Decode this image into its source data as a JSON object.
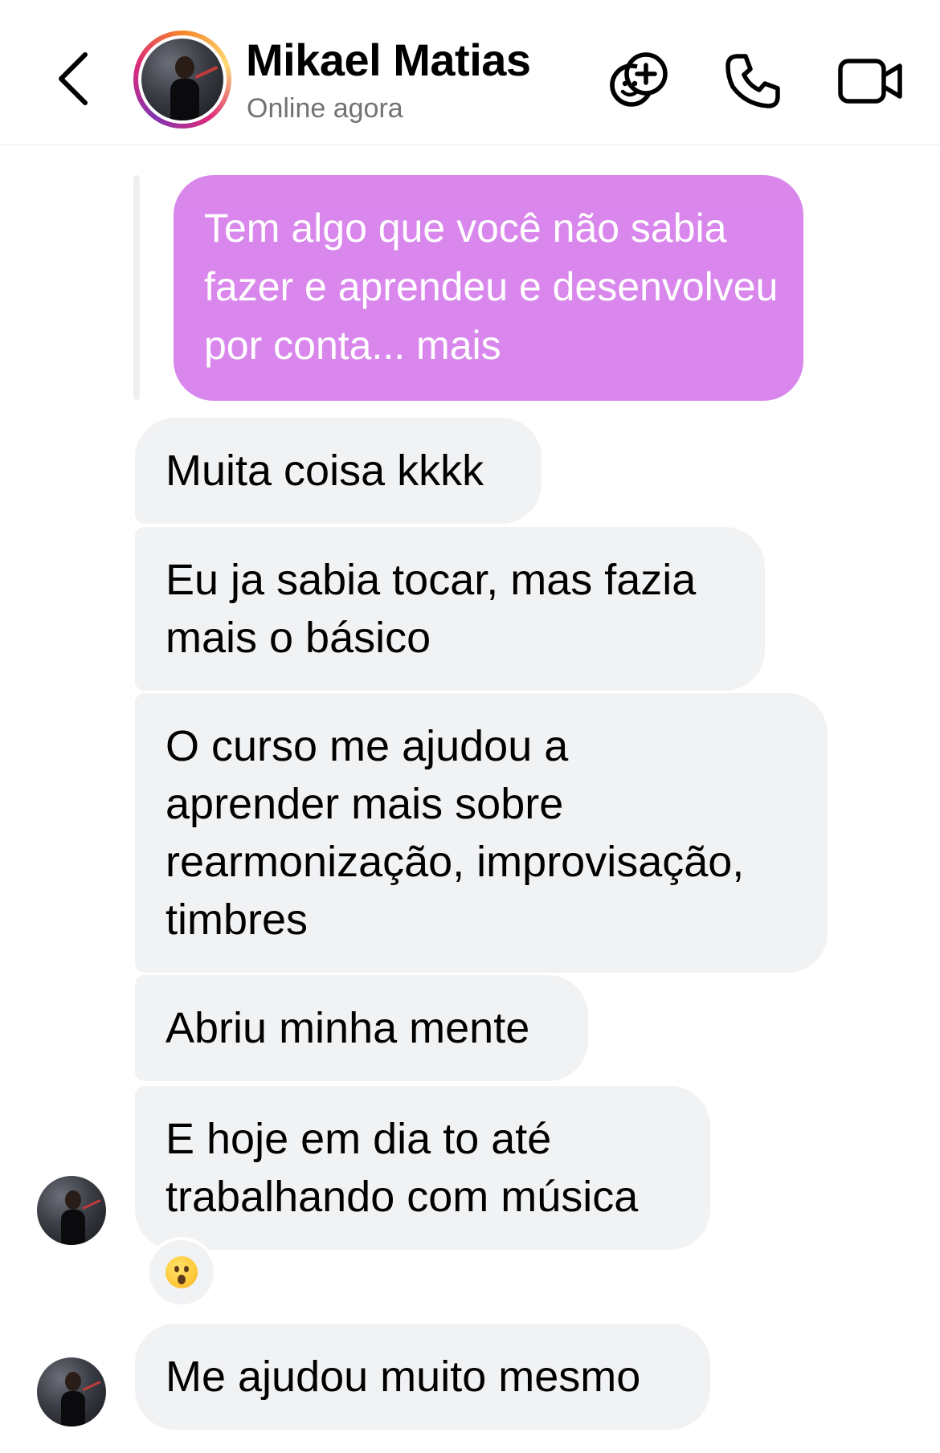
{
  "header": {
    "contact_name": "Mikael Matias",
    "contact_status": "Online agora",
    "icons": {
      "back": "chevron-left-icon",
      "avatar": "profile-photo",
      "group": "add-people-icon",
      "call": "phone-icon",
      "video": "video-camera-icon"
    }
  },
  "messages": {
    "sent_reply": "Tem algo que você não sabia fazer e aprendeu e desenvolveu por conta... mais",
    "received": [
      "Muita coisa kkkk",
      "Eu ja sabia tocar, mas fazia\nmais o básico",
      "O curso me ajudou a\naprender mais sobre\nrearmonização, improvisação,\ntimbres",
      "Abriu minha mente",
      "E hoje em dia to até\ntrabalhando com música",
      "Me ajudou muito mesmo"
    ],
    "reaction_emoji": "hushed-face-emoji"
  },
  "colors": {
    "sent_bubble": "#d985ec",
    "received_bubble": "#f1f2f4",
    "status_text": "#737373"
  }
}
